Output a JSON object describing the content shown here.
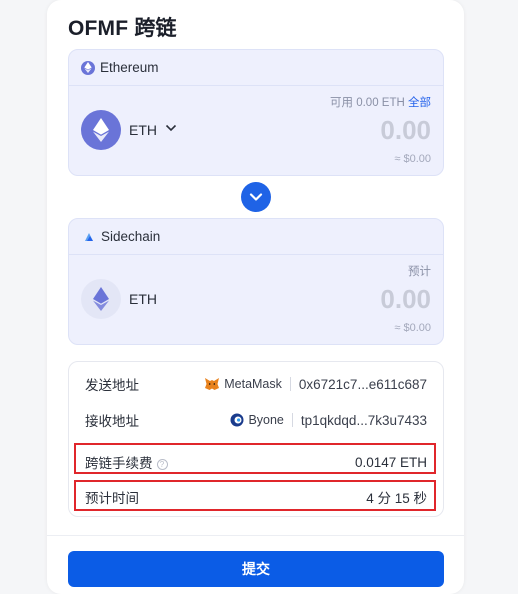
{
  "title": "OFMF 跨链",
  "from": {
    "network": "Ethereum",
    "token": "ETH",
    "available_label": "可用",
    "available_value": "0.00 ETH",
    "all_label": "全部",
    "amount": "0.00",
    "usd": "≈ $0.00"
  },
  "to": {
    "network": "Sidechain",
    "token": "ETH",
    "estimate_label": "预计",
    "amount": "0.00",
    "usd": "≈ $0.00"
  },
  "details": {
    "send_label": "发送地址",
    "send_wallet": "MetaMask",
    "send_address": "0x6721c7...e611c687",
    "receive_label": "接收地址",
    "receive_wallet": "Byone",
    "receive_address": "tp1qkdqd...7k3u7433",
    "fee_label": "跨链手续费",
    "fee_value": "0.0147 ETH",
    "time_label": "预计时间",
    "time_value": "4 分 15 秒"
  },
  "submit_label": "提交",
  "colors": {
    "accent": "#0b5ce6",
    "highlight": "#e0262b",
    "eth": "#6a74d8"
  },
  "icons": [
    "ethereum-icon",
    "chevron-down-icon",
    "swap-arrow-icon",
    "sidechain-icon",
    "metamask-icon",
    "byone-icon",
    "info-icon"
  ]
}
